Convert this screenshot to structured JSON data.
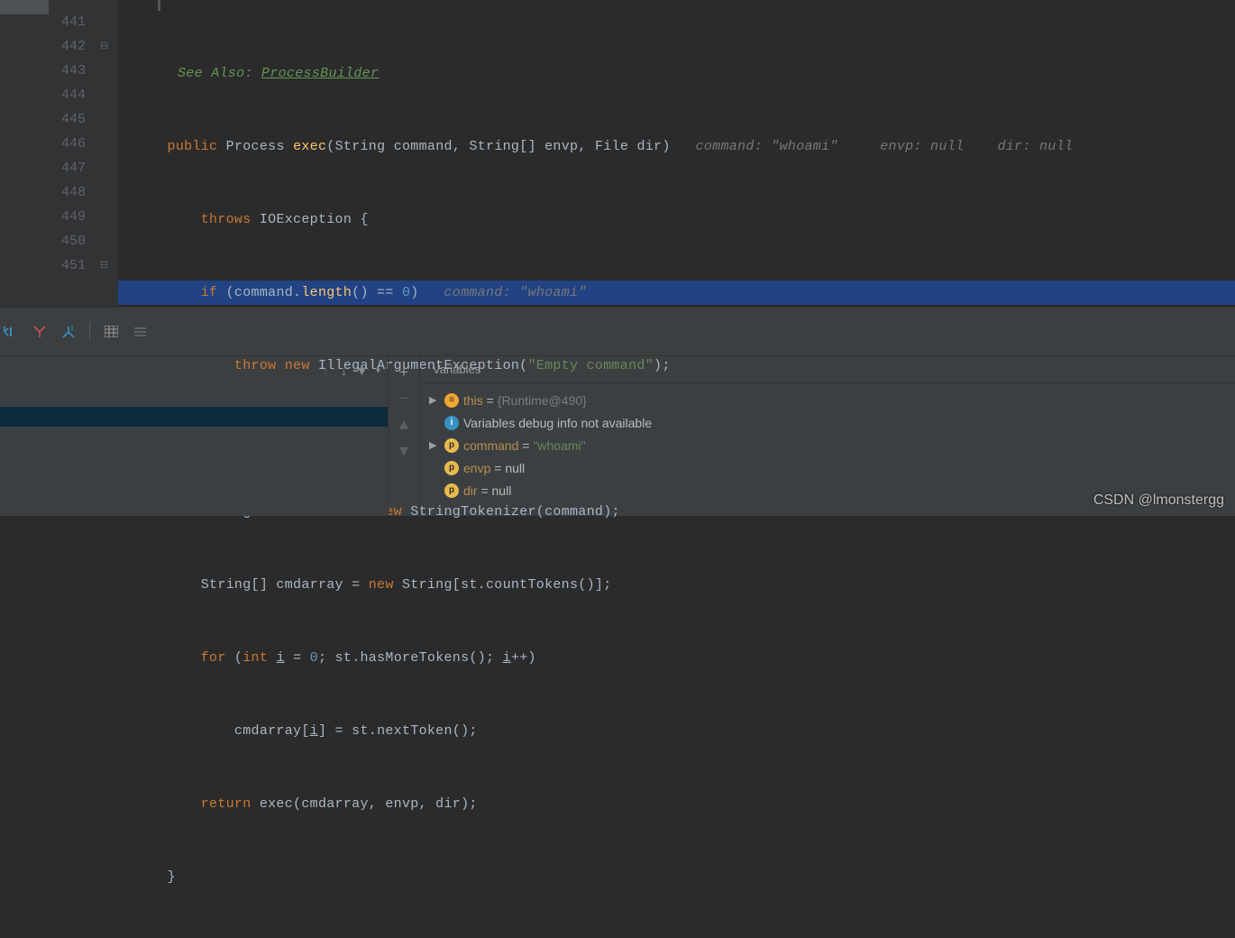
{
  "lines": [
    "441",
    "442",
    "443",
    "444",
    "445",
    "446",
    "447",
    "448",
    "449",
    "450",
    "451"
  ],
  "see_also": {
    "label": "See Also:",
    "link": "ProcessBuilder"
  },
  "code": {
    "sig_kw1": "public",
    "sig_type": "Process",
    "sig_fn": "exec",
    "sig_params": "(String command, String[] envp, File dir)",
    "hint_cmd": "command: \"whoami\"",
    "hint_envp": "envp: null",
    "hint_dir": "dir: null",
    "throws_kw": "throws",
    "throws_rest": "IOException {",
    "if_kw": "if",
    "if_open": " (command.",
    "if_fn": "length",
    "if_mid": "() == ",
    "if_num": "0",
    "if_close": ")",
    "if_hint": "command: \"whoami\"",
    "throw_kw": "throw new",
    "throw_type": " IllegalArgumentException(",
    "throw_str": "\"Empty command\"",
    "throw_end": ");",
    "tok1": "StringTokenizer st = ",
    "tok_new": "new",
    "tok2": " StringTokenizer(command);",
    "arr1": "String[] cmdarray = ",
    "arr_new": "new",
    "arr2": " String[st.countTokens()];",
    "for_kw": "for",
    "for_open": " (",
    "for_int": "int",
    "for_i1": "i",
    "for_eq": " = ",
    "for_zero": "0",
    "for_mid": "; st.hasMoreTokens(); ",
    "for_i2": "i",
    "for_inc": "++)",
    "body1": "cmdarray[",
    "body_i": "i",
    "body2": "] = st.nextToken();",
    "ret_kw": "return",
    "ret_rest": " exec(cmdarray, envp, dir);",
    "close": "}"
  },
  "variables": {
    "title": "Variables",
    "this_name": "this",
    "this_eq": " = ",
    "this_val": "{Runtime@490}",
    "info": "Variables debug info not available",
    "cmd_name": "command",
    "cmd_eq": " = ",
    "cmd_val": "\"whoami\"",
    "envp_name": "envp",
    "envp_rest": " = null",
    "dir_name": "dir",
    "dir_rest": " = null"
  },
  "watermark": "CSDN @lmonstergg"
}
